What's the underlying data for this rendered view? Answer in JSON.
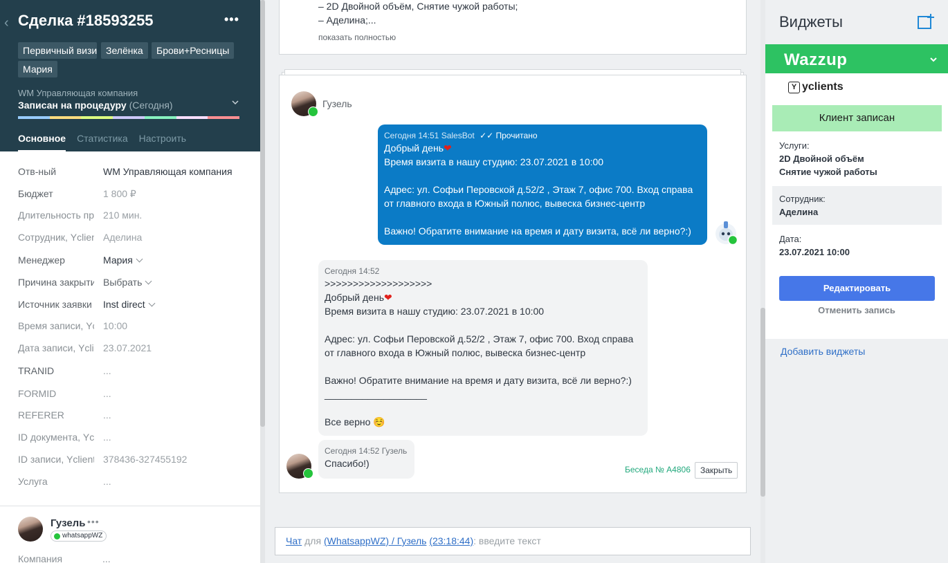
{
  "deal": {
    "title": "Сделка #18593255",
    "tags": [
      "Первичный визит",
      "Зелёнка",
      "Брови+Ресницы",
      "Мария"
    ],
    "company": "WM Управляющая компания",
    "stage": "Записан на процедуру",
    "stage_note": "(Сегодня)",
    "pipeline_colors": [
      "#99ccff",
      "#ffdc7f",
      "#deff81",
      "#ccc8f9",
      "#87f2c0",
      "#f9deff",
      "#ff8f92"
    ],
    "tabs": [
      "Основное",
      "Статистика",
      "Настроить"
    ],
    "fields": [
      {
        "label": "Отв-ный",
        "value": "WM Управляющая компания"
      },
      {
        "label": "Бюджет",
        "value": "1 800  ₽"
      },
      {
        "label": "Длительность процедуры",
        "value": "210 мин."
      },
      {
        "label": "Сотрудник, Yclients",
        "value": "Аделина"
      },
      {
        "label": "Менеджер",
        "value": "Мария"
      },
      {
        "label": "Причина закрытия",
        "value": "Выбрать"
      },
      {
        "label": "Источник заявки",
        "value": "Inst direct"
      },
      {
        "label": "Время записи, Yclients",
        "value": "10:00"
      },
      {
        "label": "Дата записи, Yclients",
        "value": "23.07.2021"
      },
      {
        "label": "TRANID",
        "value": "..."
      },
      {
        "label": "FORMID",
        "value": "..."
      },
      {
        "label": "REFERER",
        "value": "..."
      },
      {
        "label": "ID документа, Yclients",
        "value": "..."
      },
      {
        "label": "ID записи, Yclients",
        "value": "378436-327455192"
      },
      {
        "label": "Услуга",
        "value": "..."
      }
    ],
    "contact": {
      "name": "Гузель",
      "channel": "whatsappWZ",
      "company_label": "Компания",
      "company_value": "..."
    }
  },
  "note": {
    "line1": "– 2D Двойной объём, Снятие чужой работы;",
    "line2": "– Аделина;...",
    "more": "показать полностью"
  },
  "chat": {
    "contact_name": "Гузель",
    "outgoing": {
      "meta": "Сегодня 14:51 SalesBot",
      "status": "✓✓ Прочитано",
      "lines": [
        "Добрый день",
        "Время визита в нашу студию: 23.07.2021  в 10:00",
        "",
        "Адрес: ул. Софьи Перовской д.52/2 , Этаж 7, офис 700. Вход справа от главного входа в Южный полюс, вывеска бизнес-центр",
        "",
        "Важно! Обратите внимание на время и дату визита, всё ли верно?:)"
      ]
    },
    "incoming1": {
      "meta": "Сегодня 14:52",
      "lines": [
        ">>>>>>>>>>>>>>>>>>>",
        "Добрый день",
        "Время визита в нашу студию: 23.07.2021  в 10:00",
        "",
        "Адрес: ул. Софьи Перовской д.52/2 , Этаж 7, офис 700. Вход справа от главного входа в Южный полюс, вывеска бизнес-центр",
        "",
        "Важно! Обратите внимание на время и дату визита, всё ли верно?:)",
        "___________________",
        "",
        "Все верно ☺️"
      ]
    },
    "incoming2": {
      "meta": "Сегодня 14:52 Гузель",
      "text": "Спасибо!)"
    },
    "talk_label": "Беседа № A4806",
    "close_label": "Закрыть"
  },
  "input": {
    "chat_label": "Чат",
    "for_label": "для",
    "target": "(WhatsappWZ) / Гузель",
    "time": "(23:18:44)",
    "placeholder": ": введите текст"
  },
  "widgets": {
    "title": "Виджеты",
    "wazzup": "Wazzup",
    "yclients": "yclients",
    "booked": "Клиент записан",
    "services_label": "Услуги:",
    "services": [
      "2D Двойной объём",
      "Снятие чужой работы"
    ],
    "employee_label": "Сотрудник:",
    "employee": "Аделина",
    "date_label": "Дата:",
    "date": "23.07.2021 10:00",
    "edit": "Редактировать",
    "cancel": "Отменить запись",
    "add": "Добавить виджеты",
    "colors": {
      "wazzup": "#2dc262",
      "booked": "#a9ecb6",
      "edit": "#4677e8"
    }
  }
}
